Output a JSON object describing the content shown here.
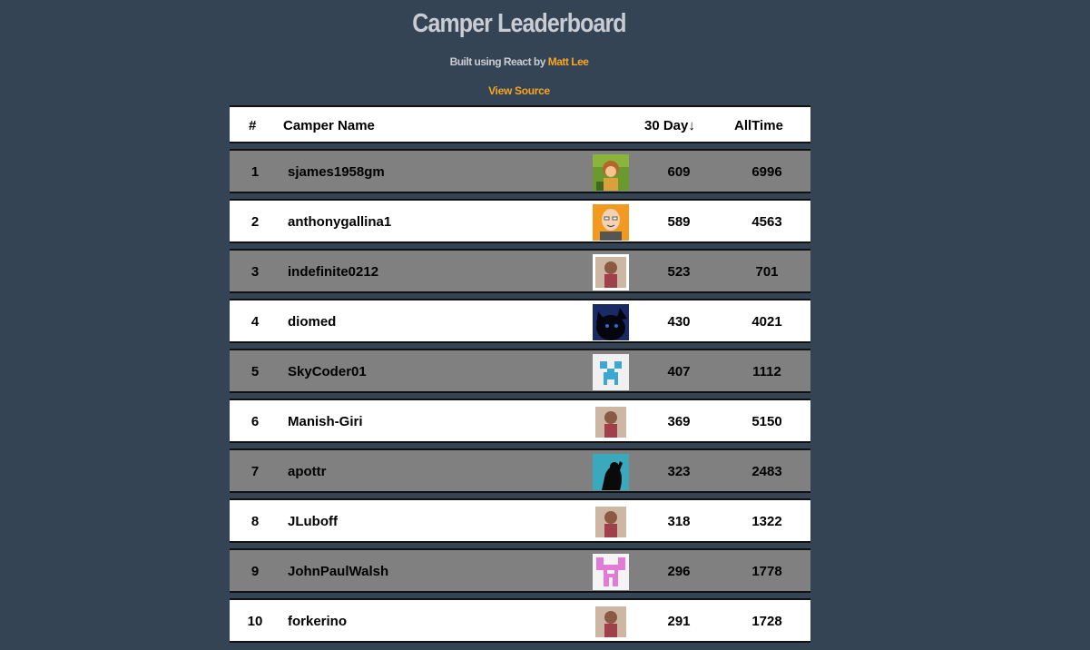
{
  "header": {
    "title": "Camper Leaderboard",
    "built_prefix": "Built using React by ",
    "author": "Matt Lee",
    "source_link": "View Source"
  },
  "table": {
    "col_rank": "#",
    "col_name": "Camper Name",
    "col_recent": "30 Day↓",
    "col_alltime": "AllTime",
    "rows": [
      {
        "rank": "1",
        "name": "sjames1958gm",
        "recent": "609",
        "alltime": "6996",
        "avatar": "cartoon-character-avatar"
      },
      {
        "rank": "2",
        "name": "anthonygallina1",
        "recent": "589",
        "alltime": "4563",
        "avatar": "cartoon-face-avatar"
      },
      {
        "rank": "3",
        "name": "indefinite0212",
        "recent": "523",
        "alltime": "701",
        "avatar": "photo-person-avatar"
      },
      {
        "rank": "4",
        "name": "diomed",
        "recent": "430",
        "alltime": "4021",
        "avatar": "black-cat-avatar"
      },
      {
        "rank": "5",
        "name": "SkyCoder01",
        "recent": "407",
        "alltime": "1112",
        "avatar": "creeper-face-avatar"
      },
      {
        "rank": "6",
        "name": "Manish-Giri",
        "recent": "369",
        "alltime": "5150",
        "avatar": "photo-person-avatar"
      },
      {
        "rank": "7",
        "name": "apottr",
        "recent": "323",
        "alltime": "2483",
        "avatar": "silhouette-avatar"
      },
      {
        "rank": "8",
        "name": "JLuboff",
        "recent": "318",
        "alltime": "1322",
        "avatar": "photo-person-avatar"
      },
      {
        "rank": "9",
        "name": "JohnPaulWalsh",
        "recent": "296",
        "alltime": "1778",
        "avatar": "pixel-identicon-avatar"
      },
      {
        "rank": "10",
        "name": "forkerino",
        "recent": "291",
        "alltime": "1728",
        "avatar": "photo-person-avatar"
      }
    ]
  },
  "colors": {
    "background": "#344455",
    "accent": "#f6a623",
    "odd_row": "#808080",
    "even_row": "#ffffff"
  }
}
